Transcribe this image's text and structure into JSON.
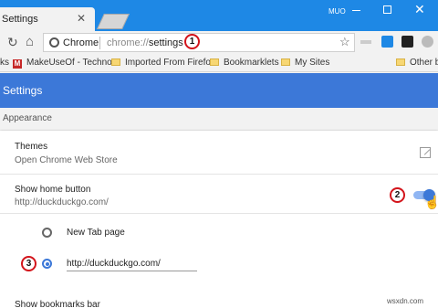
{
  "tab": {
    "title": "Settings",
    "close": "✕"
  },
  "window": {
    "user": "MUO",
    "close": "✕"
  },
  "toolbar": {
    "reload": "↻",
    "home": "⌂",
    "omnibox_chip": "Chrome",
    "url_scheme": "chrome://",
    "url_path": "settings",
    "star": "☆"
  },
  "bookmarks": [
    {
      "label": "ks",
      "icon": "none"
    },
    {
      "label": "MakeUseOf - Techno",
      "icon": "muo-icon",
      "badge": "M"
    },
    {
      "label": "Imported From Firefo",
      "icon": "folder-icon"
    },
    {
      "label": "Bookmarklets",
      "icon": "folder-icon"
    },
    {
      "label": "My Sites",
      "icon": "folder-icon"
    },
    {
      "label": "Other b",
      "icon": "folder-icon"
    }
  ],
  "header": {
    "title": "Settings"
  },
  "section": {
    "title": "Appearance"
  },
  "themes": {
    "label": "Themes",
    "sub": "Open Chrome Web Store"
  },
  "home_button": {
    "label": "Show home button",
    "url": "http://duckduckgo.com/",
    "enabled": true
  },
  "radio_options": [
    {
      "label": "New Tab page",
      "checked": false
    },
    {
      "value": "http://duckduckgo.com/",
      "checked": true
    }
  ],
  "bookmarks_bar": {
    "label": "Show bookmarks bar"
  },
  "callouts": [
    "1",
    "2",
    "3"
  ],
  "watermark": "wsxdn.com",
  "colors": {
    "titlebar": "#1e88e5",
    "header": "#3c78d8",
    "callout_border": "#d3141b",
    "toggle": "#3c78d8"
  }
}
